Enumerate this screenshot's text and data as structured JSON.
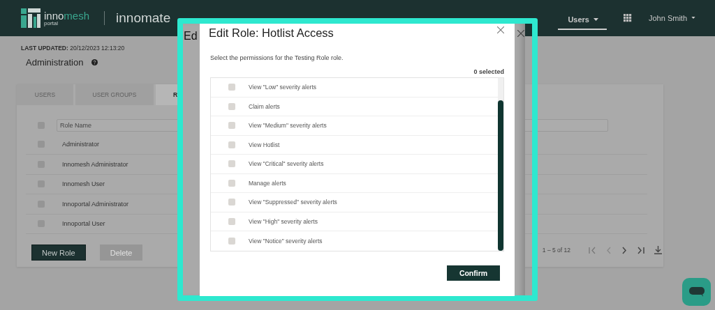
{
  "header": {
    "logo_name": "inno**mesh**",
    "logo_sub": "portal",
    "brand": "innomate",
    "nav": [
      {
        "label": "Users",
        "selected": true
      },
      {
        "label": "John Smith",
        "selected": false
      }
    ]
  },
  "page": {
    "last_updated": "**LAST UPDATED:** 20/12/2023 12:13:20",
    "title": "Administration"
  },
  "tabs": [
    {
      "label": "USERS",
      "selected": false
    },
    {
      "label": "USER GROUPS",
      "selected": false
    },
    {
      "label": "R",
      "selected": true
    }
  ],
  "table": {
    "all_checked": false,
    "filter_placeholder": "Role Name",
    "rows": [
      {
        "name": "Administrator",
        "checked": false
      },
      {
        "name": "Innomesh Administrator",
        "checked": false
      },
      {
        "name": "Innomesh User",
        "checked": false
      },
      {
        "name": "Innoportal Administrator",
        "checked": false
      },
      {
        "name": "Innoportal User",
        "checked": false
      }
    ]
  },
  "buttons": [
    {
      "label": "New Role",
      "disabled": false
    },
    {
      "label": "Delete",
      "disabled": true
    }
  ],
  "pagination": {
    "range": "1 – 5 of 12"
  },
  "dialog_behind": {
    "title": "Ed"
  },
  "dialog": {
    "title": "Edit Role: Hotlist Access",
    "description": "Select the permissions for the Testing Role role.",
    "selected_count": "0 selected",
    "permissions": [
      {
        "label": "View \"Low\" severity alerts",
        "checked": false
      },
      {
        "label": "Claim alerts",
        "checked": false
      },
      {
        "label": "View \"Medium\" severity alerts",
        "checked": false
      },
      {
        "label": "View Hotlist",
        "checked": false
      },
      {
        "label": "View \"Critical\" severity alerts",
        "checked": false
      },
      {
        "label": "Manage alerts",
        "checked": false
      },
      {
        "label": "View \"Suppressed\" severity alerts",
        "checked": false
      },
      {
        "label": "View \"High\" severity alerts",
        "checked": false
      },
      {
        "label": "View \"Notice\" severity alerts",
        "checked": false
      }
    ],
    "confirm": "Confirm"
  }
}
